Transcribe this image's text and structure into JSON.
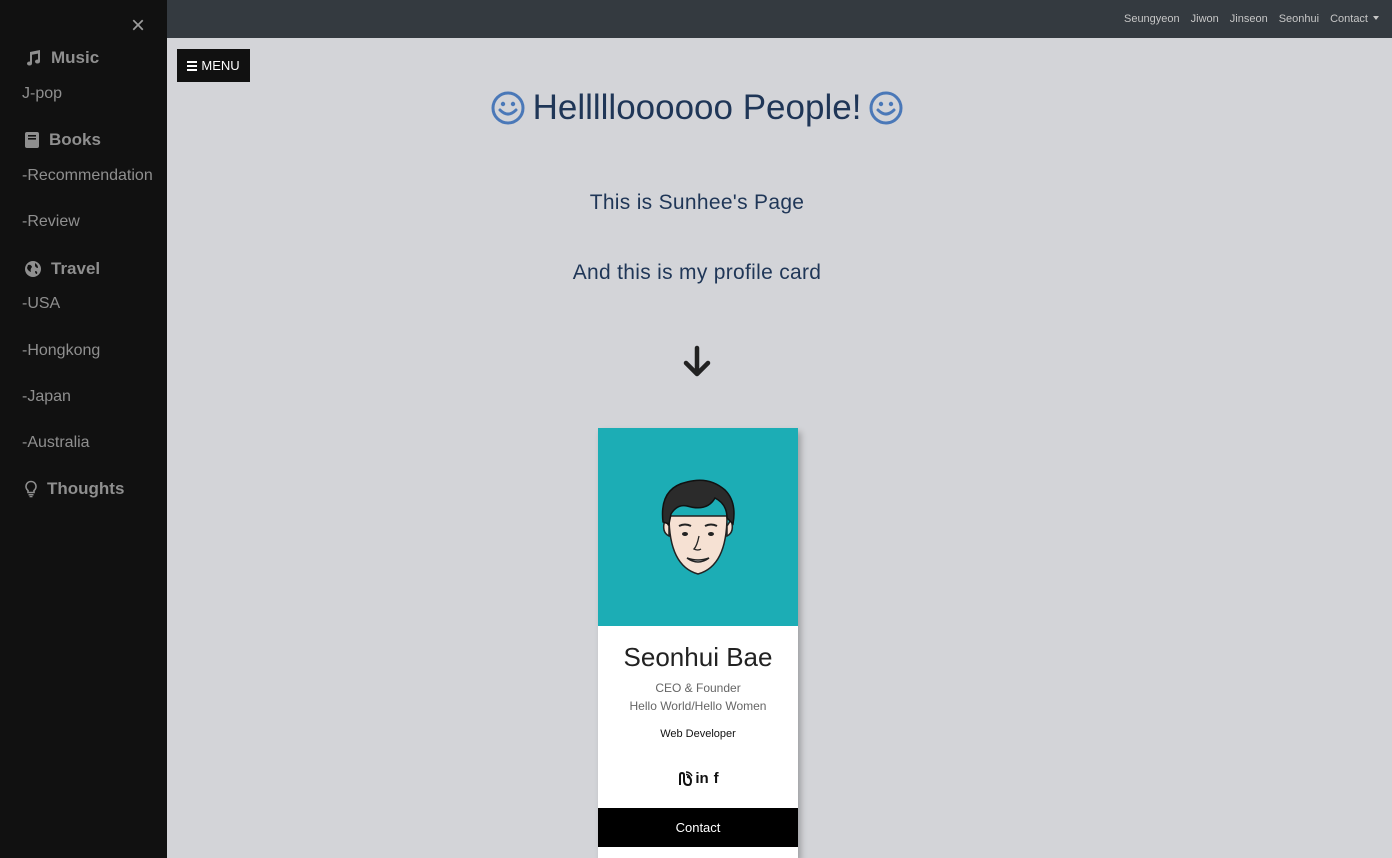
{
  "sidebar": {
    "close_label": "×",
    "sections": [
      {
        "icon": "music-icon",
        "label": "Music"
      },
      {
        "icon": "book-icon",
        "label": "Books"
      },
      {
        "icon": "globe-icon",
        "label": "Travel"
      },
      {
        "icon": "lightbulb-icon",
        "label": "Thoughts"
      }
    ],
    "music_items": [
      "J-pop"
    ],
    "book_items": [
      "-Recommendation",
      "-Review"
    ],
    "travel_items": [
      "-USA",
      "-Hongkong",
      "-Japan",
      "-Australia"
    ]
  },
  "topnav": {
    "links": [
      "Seungyeon",
      "Jiwon",
      "Jinseon",
      "Seonhui"
    ],
    "dropdown": "Contact"
  },
  "menu_button": {
    "label": "MENU"
  },
  "main": {
    "title": "Hellllloooooo People!",
    "line1": "This is Sunhee's Page",
    "line2": "And this is my profile card"
  },
  "card": {
    "name": "Seonhui Bae",
    "role": "CEO & Founder",
    "tagline": "Hello World/Hello Women",
    "job": "Web Developer",
    "socials": [
      "dribbble",
      "in",
      "f"
    ],
    "contact_label": "Contact"
  },
  "colors": {
    "sidebar_bg": "#111111",
    "navbar_bg": "#343a40",
    "page_bg": "#d3d4d8",
    "heading": "#1f3657",
    "smile": "#4a78b8",
    "card_top": "#1cadb5"
  }
}
